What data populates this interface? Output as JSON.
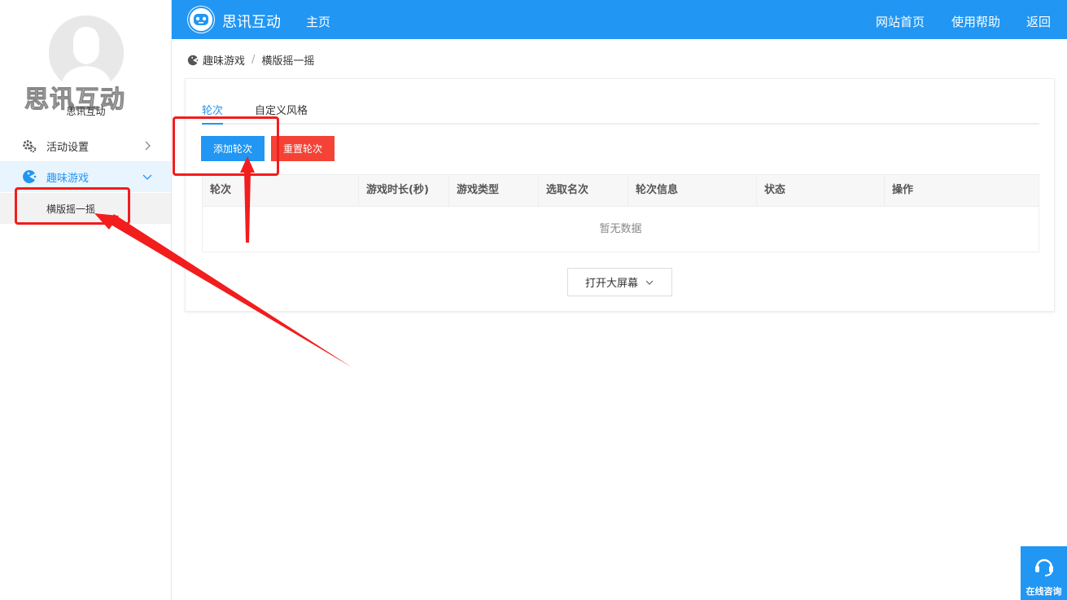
{
  "sidebar": {
    "logo_text": "思讯互动",
    "org_name": "思讯互动",
    "menu": [
      {
        "label": "活动设置",
        "icon": "gears-icon"
      },
      {
        "label": "趣味游戏",
        "icon": "pacman-icon"
      }
    ],
    "sub_item": "横版摇一摇"
  },
  "header": {
    "brand": "思讯互动",
    "home": "主页",
    "links": [
      "网站首页",
      "使用帮助",
      "返回"
    ]
  },
  "breadcrumb": {
    "items": [
      "趣味游戏",
      "横版摇一摇"
    ],
    "separator": "/"
  },
  "tabs": [
    "轮次",
    "自定义风格"
  ],
  "buttons": {
    "add": "添加轮次",
    "reset": "重置轮次"
  },
  "table": {
    "columns": [
      "轮次",
      "游戏时长(秒)",
      "游戏类型",
      "选取名次",
      "轮次信息",
      "状态",
      "操作"
    ],
    "empty_text": "暂无数据"
  },
  "screen_button": "打开大屏幕",
  "consult": "在线咨询",
  "colors": {
    "primary": "#2196f3",
    "danger": "#f44336",
    "annotation": "#f21d1d"
  }
}
